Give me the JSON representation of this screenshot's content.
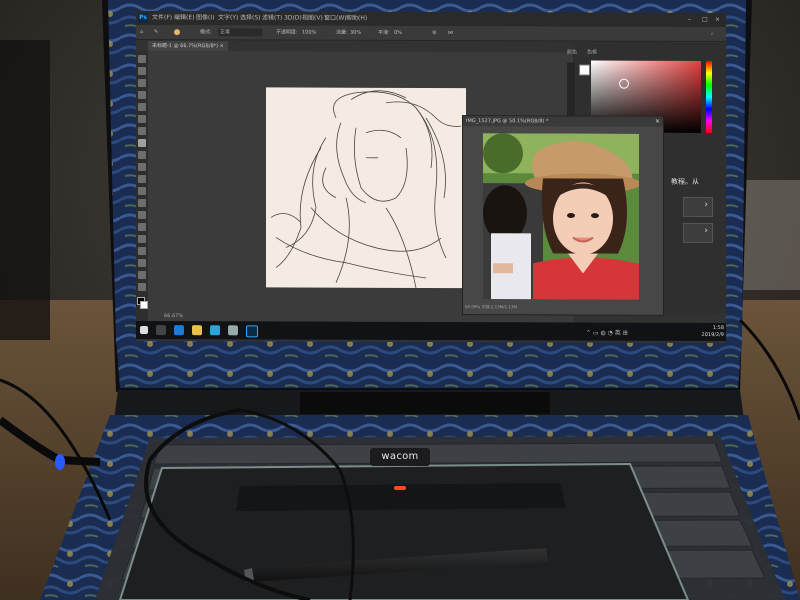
{
  "photoshop": {
    "logo": "Ps",
    "menu": [
      "文件(F)",
      "编辑(E)",
      "图像(I)",
      "文字(Y)",
      "选择(S)",
      "滤镜(T)",
      "3D(D)",
      "视图(V)",
      "窗口(W)",
      "帮助(H)"
    ],
    "options": {
      "mode_label": "模式:",
      "mode_value": "正常",
      "opacity_label": "不透明度:",
      "opacity_value": "100%",
      "flow_label": "流量:",
      "flow_value": "30%",
      "smooth_label": "平滑:",
      "smooth_value": "0%"
    },
    "document_tab": "未标题-1 @ 66.7%(RGB/8*) ×",
    "document_status": "66.67%",
    "panels": {
      "tab1": "颜色",
      "tab2": "色板",
      "learn_text": "教程。从"
    },
    "photo_window": {
      "title": "IMG_1527.JPG @ 50.1%(RGB/8) *",
      "status": "50.09%      文档:1.13M/1.13M"
    },
    "taskbar": {
      "time": "1:58",
      "date": "2019/2/9"
    }
  },
  "device": {
    "brand": "wacom"
  },
  "colors": {
    "ps_bg": "#323232",
    "ps_accent": "#31a8ff",
    "tablet_led": "#ff4a1a",
    "cable_led": "#2a5bff"
  },
  "icons": [
    "move-tool-icon",
    "marquee-tool-icon",
    "lasso-tool-icon",
    "brush-tool-icon",
    "eraser-tool-icon",
    "text-tool-icon",
    "hand-tool-icon",
    "zoom-tool-icon",
    "windows-start-icon",
    "edge-browser-icon",
    "file-explorer-icon",
    "store-icon",
    "photoshop-taskbar-icon"
  ]
}
